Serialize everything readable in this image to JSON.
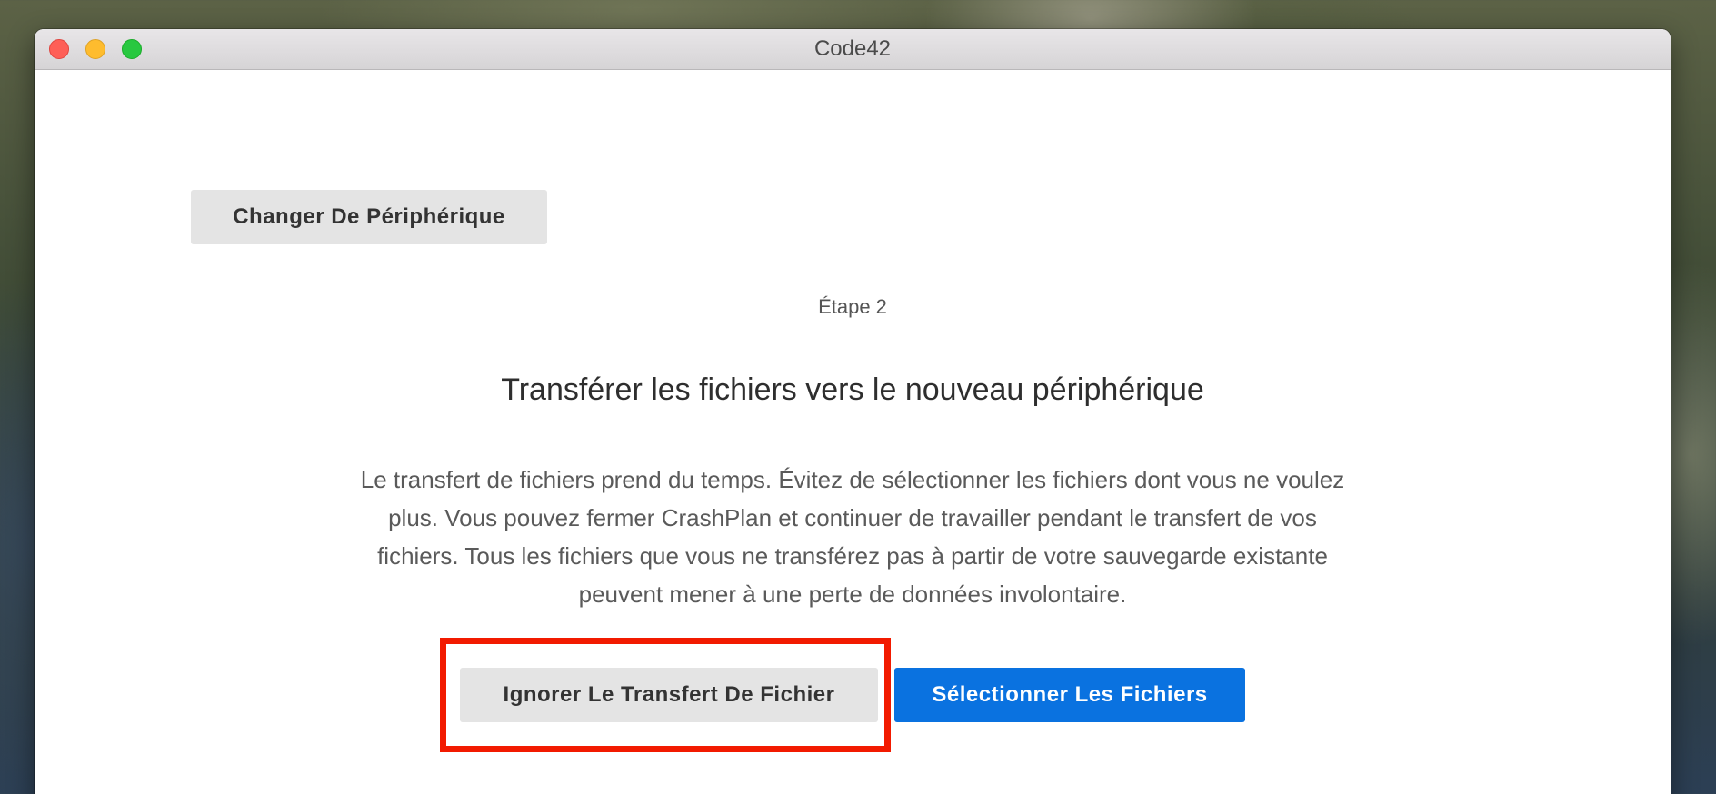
{
  "window": {
    "title": "Code42"
  },
  "header": {
    "change_device_label": "Changer De Périphérique"
  },
  "main": {
    "step_label": "Étape 2",
    "heading": "Transférer les fichiers vers le nouveau périphérique",
    "description": "Le transfert de fichiers prend du temps. Évitez de sélectionner les fichiers dont vous ne voulez plus. Vous pouvez fermer CrashPlan et continuer de travailler pendant le transfert de vos fichiers. Tous les fichiers que vous ne transférez pas à partir de votre sauvegarde existante peuvent mener à une perte de données involontaire."
  },
  "actions": {
    "skip_label": "Ignorer Le Transfert De Fichier",
    "select_label": "Sélectionner Les Fichiers"
  },
  "colors": {
    "primary_button": "#0a72e0",
    "secondary_button": "#e4e4e4",
    "highlight_outline": "#f21a00",
    "close_light": "#fe5f57",
    "minimize_light": "#febc2e",
    "maximize_light": "#28c840"
  },
  "icons": {
    "close": "close-icon",
    "minimize": "minimize-icon",
    "maximize": "maximize-icon"
  }
}
